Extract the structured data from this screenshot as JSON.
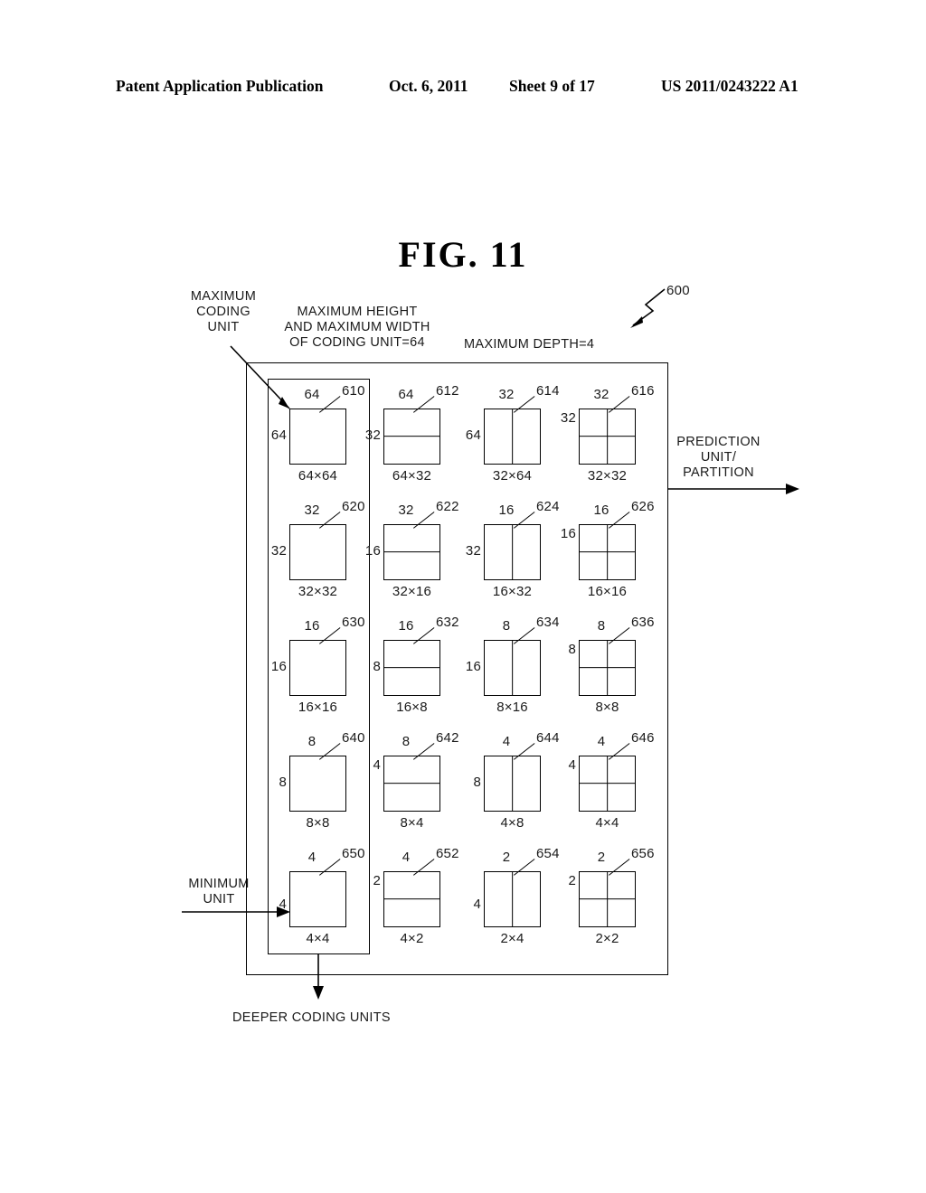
{
  "header": {
    "publication": "Patent Application Publication",
    "date": "Oct. 6, 2011",
    "sheet": "Sheet 9 of 17",
    "number": "US 2011/0243222 A1"
  },
  "figure": {
    "title": "FIG.  11",
    "diagram_ref": "600"
  },
  "annotations": {
    "maximum_coding_unit": "MAXIMUM\nCODING\nUNIT",
    "max_height_width": "MAXIMUM HEIGHT\nAND MAXIMUM WIDTH\nOF CODING UNIT=64",
    "maximum_depth": "MAXIMUM DEPTH=4",
    "prediction_unit": "PREDICTION\nUNIT/\nPARTITION",
    "minimum_unit": "MINIMUM\nUNIT",
    "deeper_coding_units": "DEEPER CODING UNITS"
  },
  "grid": {
    "rows": [
      {
        "cells": [
          {
            "ref": "610",
            "top": "64",
            "side": "64",
            "bottom": "64×64",
            "split": "none",
            "side_align": "middle"
          },
          {
            "ref": "612",
            "top": "64",
            "side": "32",
            "bottom": "64×32",
            "split": "horizontal",
            "side_align": "middle"
          },
          {
            "ref": "614",
            "top": "32",
            "side": "64",
            "bottom": "32×64",
            "split": "vertical",
            "side_align": "middle"
          },
          {
            "ref": "616",
            "top": "32",
            "side": "32",
            "bottom": "32×32",
            "split": "quad",
            "side_align": "top"
          }
        ]
      },
      {
        "cells": [
          {
            "ref": "620",
            "top": "32",
            "side": "32",
            "bottom": "32×32",
            "split": "none",
            "side_align": "middle"
          },
          {
            "ref": "622",
            "top": "32",
            "side": "16",
            "bottom": "32×16",
            "split": "horizontal",
            "side_align": "middle"
          },
          {
            "ref": "624",
            "top": "16",
            "side": "32",
            "bottom": "16×32",
            "split": "vertical",
            "side_align": "middle"
          },
          {
            "ref": "626",
            "top": "16",
            "side": "16",
            "bottom": "16×16",
            "split": "quad",
            "side_align": "top"
          }
        ]
      },
      {
        "cells": [
          {
            "ref": "630",
            "top": "16",
            "side": "16",
            "bottom": "16×16",
            "split": "none",
            "side_align": "middle"
          },
          {
            "ref": "632",
            "top": "16",
            "side": "8",
            "bottom": "16×8",
            "split": "horizontal",
            "side_align": "middle"
          },
          {
            "ref": "634",
            "top": "8",
            "side": "16",
            "bottom": "8×16",
            "split": "vertical",
            "side_align": "middle"
          },
          {
            "ref": "636",
            "top": "8",
            "side": "8",
            "bottom": "8×8",
            "split": "quad",
            "side_align": "top"
          }
        ]
      },
      {
        "cells": [
          {
            "ref": "640",
            "top": "8",
            "side": "8",
            "bottom": "8×8",
            "split": "none",
            "side_align": "middle"
          },
          {
            "ref": "642",
            "top": "8",
            "side": "4",
            "bottom": "8×4",
            "split": "horizontal",
            "side_align": "top"
          },
          {
            "ref": "644",
            "top": "4",
            "side": "8",
            "bottom": "4×8",
            "split": "vertical",
            "side_align": "middle"
          },
          {
            "ref": "646",
            "top": "4",
            "side": "4",
            "bottom": "4×4",
            "split": "quad",
            "side_align": "top"
          }
        ]
      },
      {
        "cells": [
          {
            "ref": "650",
            "top": "4",
            "side": "4",
            "bottom": "4×4",
            "split": "none",
            "side_align": "bottom"
          },
          {
            "ref": "652",
            "top": "4",
            "side": "2",
            "bottom": "4×2",
            "split": "horizontal",
            "side_align": "top"
          },
          {
            "ref": "654",
            "top": "2",
            "side": "4",
            "bottom": "2×4",
            "split": "vertical",
            "side_align": "bottom"
          },
          {
            "ref": "656",
            "top": "2",
            "side": "2",
            "bottom": "2×2",
            "split": "quad",
            "side_align": "top"
          }
        ]
      }
    ]
  },
  "colors": {
    "ink": "#000000",
    "text": "#1a1a1a",
    "background": "#ffffff"
  }
}
